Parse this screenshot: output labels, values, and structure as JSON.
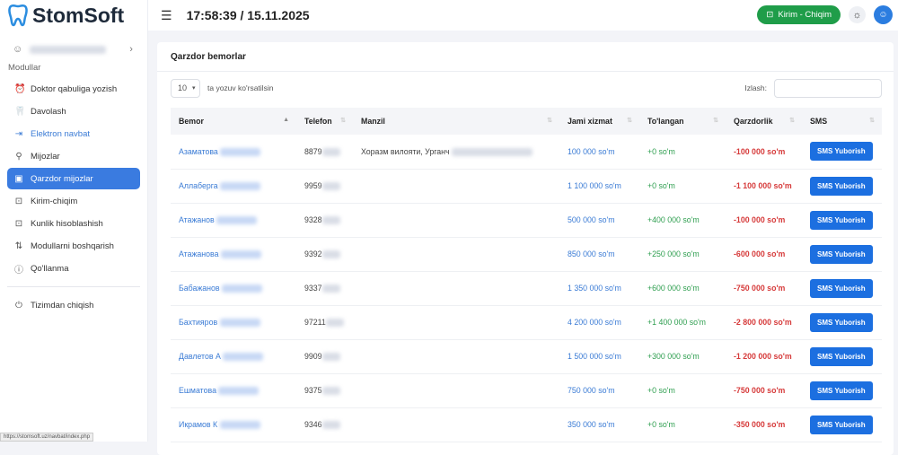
{
  "app": {
    "name": "StomSoft",
    "datetime": "17:58:39 / 15.11.2025",
    "kirim_label": "Kirim - Chiqim"
  },
  "sidebar": {
    "section": "Modullar",
    "items": [
      {
        "label": "Doktor qabuliga yozish",
        "icon": "⏰"
      },
      {
        "label": "Davolash",
        "icon": "🦷"
      },
      {
        "label": "Elektron navbat",
        "icon": "⇥"
      },
      {
        "label": "Mijozlar",
        "icon": "⚲"
      },
      {
        "label": "Qarzdor mijozlar",
        "icon": "▣"
      },
      {
        "label": "Kirim-chiqim",
        "icon": "⊡"
      },
      {
        "label": "Kunlik hisoblashish",
        "icon": "⊡"
      },
      {
        "label": "Modullarni boshqarish",
        "icon": "⇅"
      },
      {
        "label": "Qo'llanma",
        "icon": "ⓘ"
      }
    ],
    "logout": "Tizimdan chiqish"
  },
  "card": {
    "title": "Qarzdor bemorlar",
    "page_size": "10",
    "page_size_label": "ta yozuv ko'rsatilsin",
    "search_label": "Izlash:",
    "search_value": ""
  },
  "table": {
    "headers": [
      "Bemor",
      "Telefon",
      "Manzil",
      "Jami xizmat",
      "To'langan",
      "Qarzdorlik",
      "SMS"
    ],
    "sms_label": "SMS Yuborish",
    "rows": [
      {
        "name": "Азаматова",
        "phone": "8879",
        "address": "Хоразм вилояти, Урганч",
        "total": "100 000 so'm",
        "paid": "+0 so'm",
        "debt": "-100 000 so'm"
      },
      {
        "name": "Аллаберга",
        "phone": "9959",
        "address": "",
        "total": "1 100 000 so'm",
        "paid": "+0 so'm",
        "debt": "-1 100 000 so'm"
      },
      {
        "name": "Атажанов",
        "phone": "9328",
        "address": "",
        "total": "500 000 so'm",
        "paid": "+400 000 so'm",
        "debt": "-100 000 so'm"
      },
      {
        "name": "Атажанова",
        "phone": "9392",
        "address": "",
        "total": "850 000 so'm",
        "paid": "+250 000 so'm",
        "debt": "-600 000 so'm"
      },
      {
        "name": "Бабажанов",
        "phone": "9337",
        "address": "",
        "total": "1 350 000 so'm",
        "paid": "+600 000 so'm",
        "debt": "-750 000 so'm"
      },
      {
        "name": "Бахтияров",
        "phone": "97211",
        "address": "",
        "total": "4 200 000 so'm",
        "paid": "+1 400 000 so'm",
        "debt": "-2 800 000 so'm"
      },
      {
        "name": "Давлетов А",
        "phone": "9909",
        "address": "",
        "total": "1 500 000 so'm",
        "paid": "+300 000 so'm",
        "debt": "-1 200 000 so'm"
      },
      {
        "name": "Ешматова",
        "phone": "9375",
        "address": "",
        "total": "750 000 so'm",
        "paid": "+0 so'm",
        "debt": "-750 000 so'm"
      },
      {
        "name": "Икрамов К",
        "phone": "9346",
        "address": "",
        "total": "350 000 so'm",
        "paid": "+0 so'm",
        "debt": "-350 000 so'm"
      }
    ]
  },
  "status_url": "https://stomsoft.uz/navbat/index.php"
}
